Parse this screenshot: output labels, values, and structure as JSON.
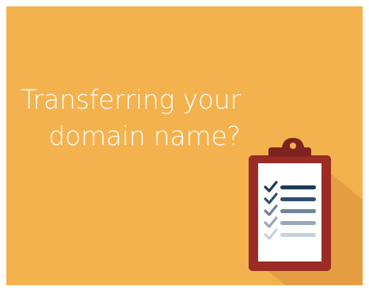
{
  "headline": {
    "line1": "Transferring your",
    "line2": "domain name?"
  },
  "colors": {
    "background": "#F4B24F",
    "shadow": "#E59E42",
    "clipboard_border": "#9B2C25",
    "clipboard_paper": "#FFFFFF",
    "clip_metal": "#7E231D",
    "text": "#FFFFFF"
  },
  "illustration": {
    "icon": "clipboard-checklist-icon",
    "checklist_items": [
      {
        "state": "checked",
        "color": "#1F3A56"
      },
      {
        "state": "checked",
        "color": "#2E4E6E"
      },
      {
        "state": "checked",
        "color": "#6F8499"
      },
      {
        "state": "checked",
        "color": "#98A8B8"
      },
      {
        "state": "checked",
        "color": "#C8D1DA"
      }
    ]
  }
}
